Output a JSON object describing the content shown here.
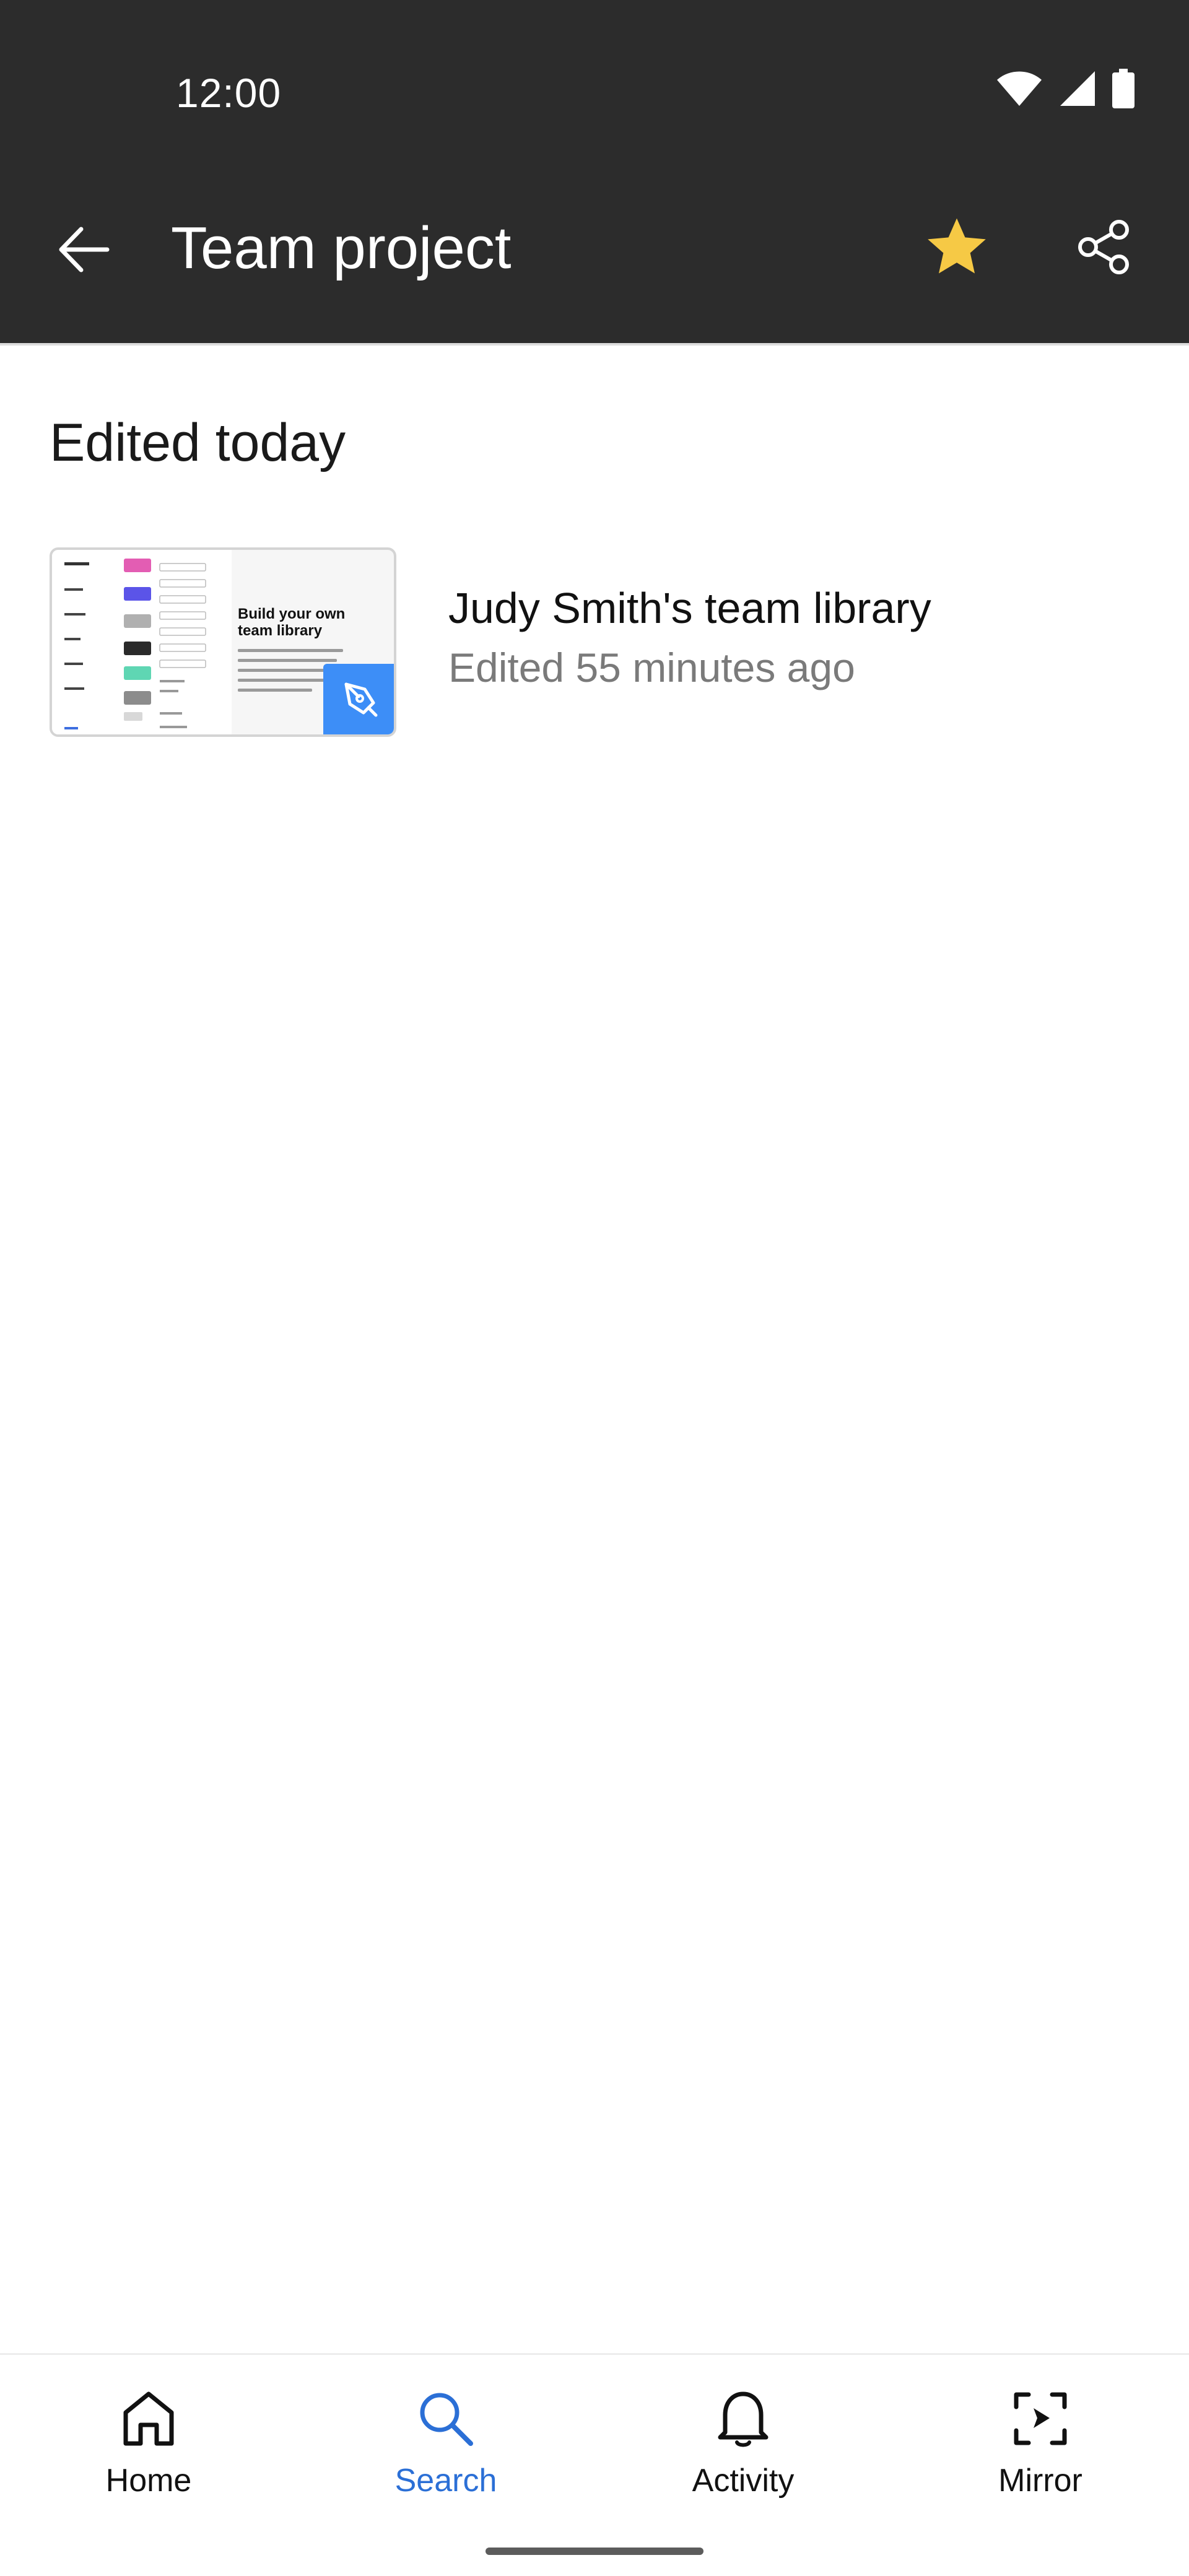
{
  "status_bar": {
    "time": "12:00",
    "icons": [
      "wifi-icon",
      "cellular-icon",
      "battery-icon"
    ]
  },
  "app_bar": {
    "title": "Team project",
    "back_icon": "arrow-left-icon",
    "star_icon": "star-icon",
    "share_icon": "share-icon",
    "star_color": "#f6c945",
    "background": "#2c2c2c"
  },
  "main": {
    "section_heading": "Edited today",
    "files": [
      {
        "name": "Judy Smith's team library",
        "meta": "Edited 55 minutes ago",
        "thumbnail_title": "Build your own team library",
        "badge_icon": "pen-tool-icon",
        "badge_color": "#3d8ef7"
      }
    ]
  },
  "bottom_nav": {
    "active": "Search",
    "accent": "#2b6fd6",
    "items": [
      {
        "label": "Home",
        "icon": "home-icon"
      },
      {
        "label": "Search",
        "icon": "search-icon"
      },
      {
        "label": "Activity",
        "icon": "bell-icon"
      },
      {
        "label": "Mirror",
        "icon": "mirror-icon"
      }
    ]
  }
}
